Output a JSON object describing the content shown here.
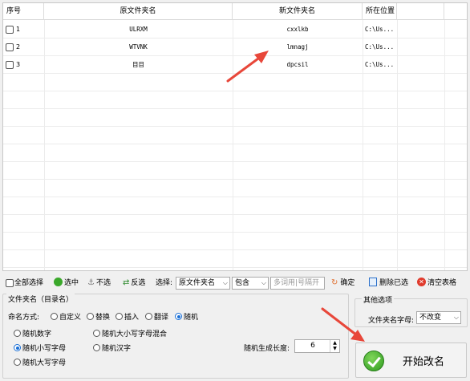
{
  "grid": {
    "headers": [
      "序号",
      "原文件夹名",
      "新文件夹名",
      "所在位置"
    ],
    "rows": [
      {
        "index": "1",
        "original": "ULRXM",
        "new": "cxxlkb",
        "location": "C:\\Us..."
      },
      {
        "index": "2",
        "original": "WTVNK",
        "new": "lmnagj",
        "location": "C:\\Us..."
      },
      {
        "index": "3",
        "original": "目目",
        "new": "dpcsil",
        "location": "C:\\Us..."
      }
    ]
  },
  "toolbar": {
    "select_all": "全部选择",
    "select": "选中",
    "unselect": "不选",
    "invert": "反选",
    "choose_label": "选择:",
    "field_combo": "原文件夹名",
    "match_combo": "包含",
    "filter_placeholder": "多词用|号隔开",
    "confirm": "确定",
    "delete_selected": "删除已选",
    "clear_table": "清空表格"
  },
  "options": {
    "title": "文件夹名（目录名）",
    "mode_label": "命名方式:",
    "modes": [
      "自定义",
      "替换",
      "插入",
      "翻译",
      "随机"
    ],
    "mode_selected": "随机",
    "random_types": [
      "随机数字",
      "随机大小写字母混合",
      "随机小写字母",
      "随机汉字",
      "随机大写字母"
    ],
    "random_selected": "随机小写字母",
    "length_label": "随机生成长度:",
    "length_value": "6"
  },
  "other": {
    "title": "其他选项",
    "case_label": "文件夹名字母:",
    "case_value": "不改变"
  },
  "start_button": "开始改名",
  "colors": {
    "arrow": "#e8473a",
    "accent": "#1a6fd6",
    "green": "#3aa82a"
  }
}
